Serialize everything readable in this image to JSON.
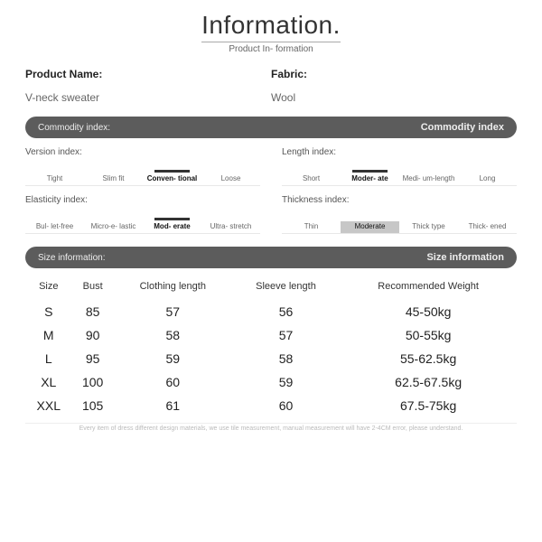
{
  "title": "Information.",
  "subtitle": "Product In-\nformation",
  "product": {
    "name_label": "Product Name:",
    "name_value": "V-neck sweater",
    "fabric_label": "Fabric:",
    "fabric_value": "Wool"
  },
  "commodity_bar": {
    "left": "Commodity index:",
    "right": "Commodity index"
  },
  "indexes": {
    "version": {
      "title": "Version index:",
      "items": [
        "Tight",
        "Slim fit",
        "Conven-\ntional",
        "Loose"
      ],
      "selected": 2
    },
    "length": {
      "title": "Length index:",
      "items": [
        "Short",
        "Moder-\nate",
        "Medi-\num-length",
        "Long"
      ],
      "selected": 1
    },
    "elasticity": {
      "title": "Elasticity index:",
      "items": [
        "Bul-\nlet-free",
        "Micro-e-\nlastic",
        "Mod-\nerate",
        "Ultra-\nstretch"
      ],
      "selected": 2
    },
    "thickness": {
      "title": "Thickness index:",
      "items": [
        "Thin",
        "Moderate",
        "Thick\ntype",
        "Thick-\nened"
      ],
      "selected": 1,
      "boxed": true
    }
  },
  "size_bar": {
    "left": "Size information:",
    "right": "Size information"
  },
  "size_table": {
    "headers": [
      "Size",
      "Bust",
      "Clothing\nlength",
      "Sleeve\nlength",
      "Recommended\nWeight"
    ],
    "rows": [
      [
        "S",
        "85",
        "57",
        "56",
        "45-50kg"
      ],
      [
        "M",
        "90",
        "58",
        "57",
        "50-55kg"
      ],
      [
        "L",
        "95",
        "59",
        "58",
        "55-62.5kg"
      ],
      [
        "XL",
        "100",
        "60",
        "59",
        "62.5-67.5kg"
      ],
      [
        "XXL",
        "105",
        "61",
        "60",
        "67.5-75kg"
      ]
    ]
  },
  "footnote": "Every item of dress different design materials, we use tile measurement, manual measurement will have 2-4CM error, please understand."
}
